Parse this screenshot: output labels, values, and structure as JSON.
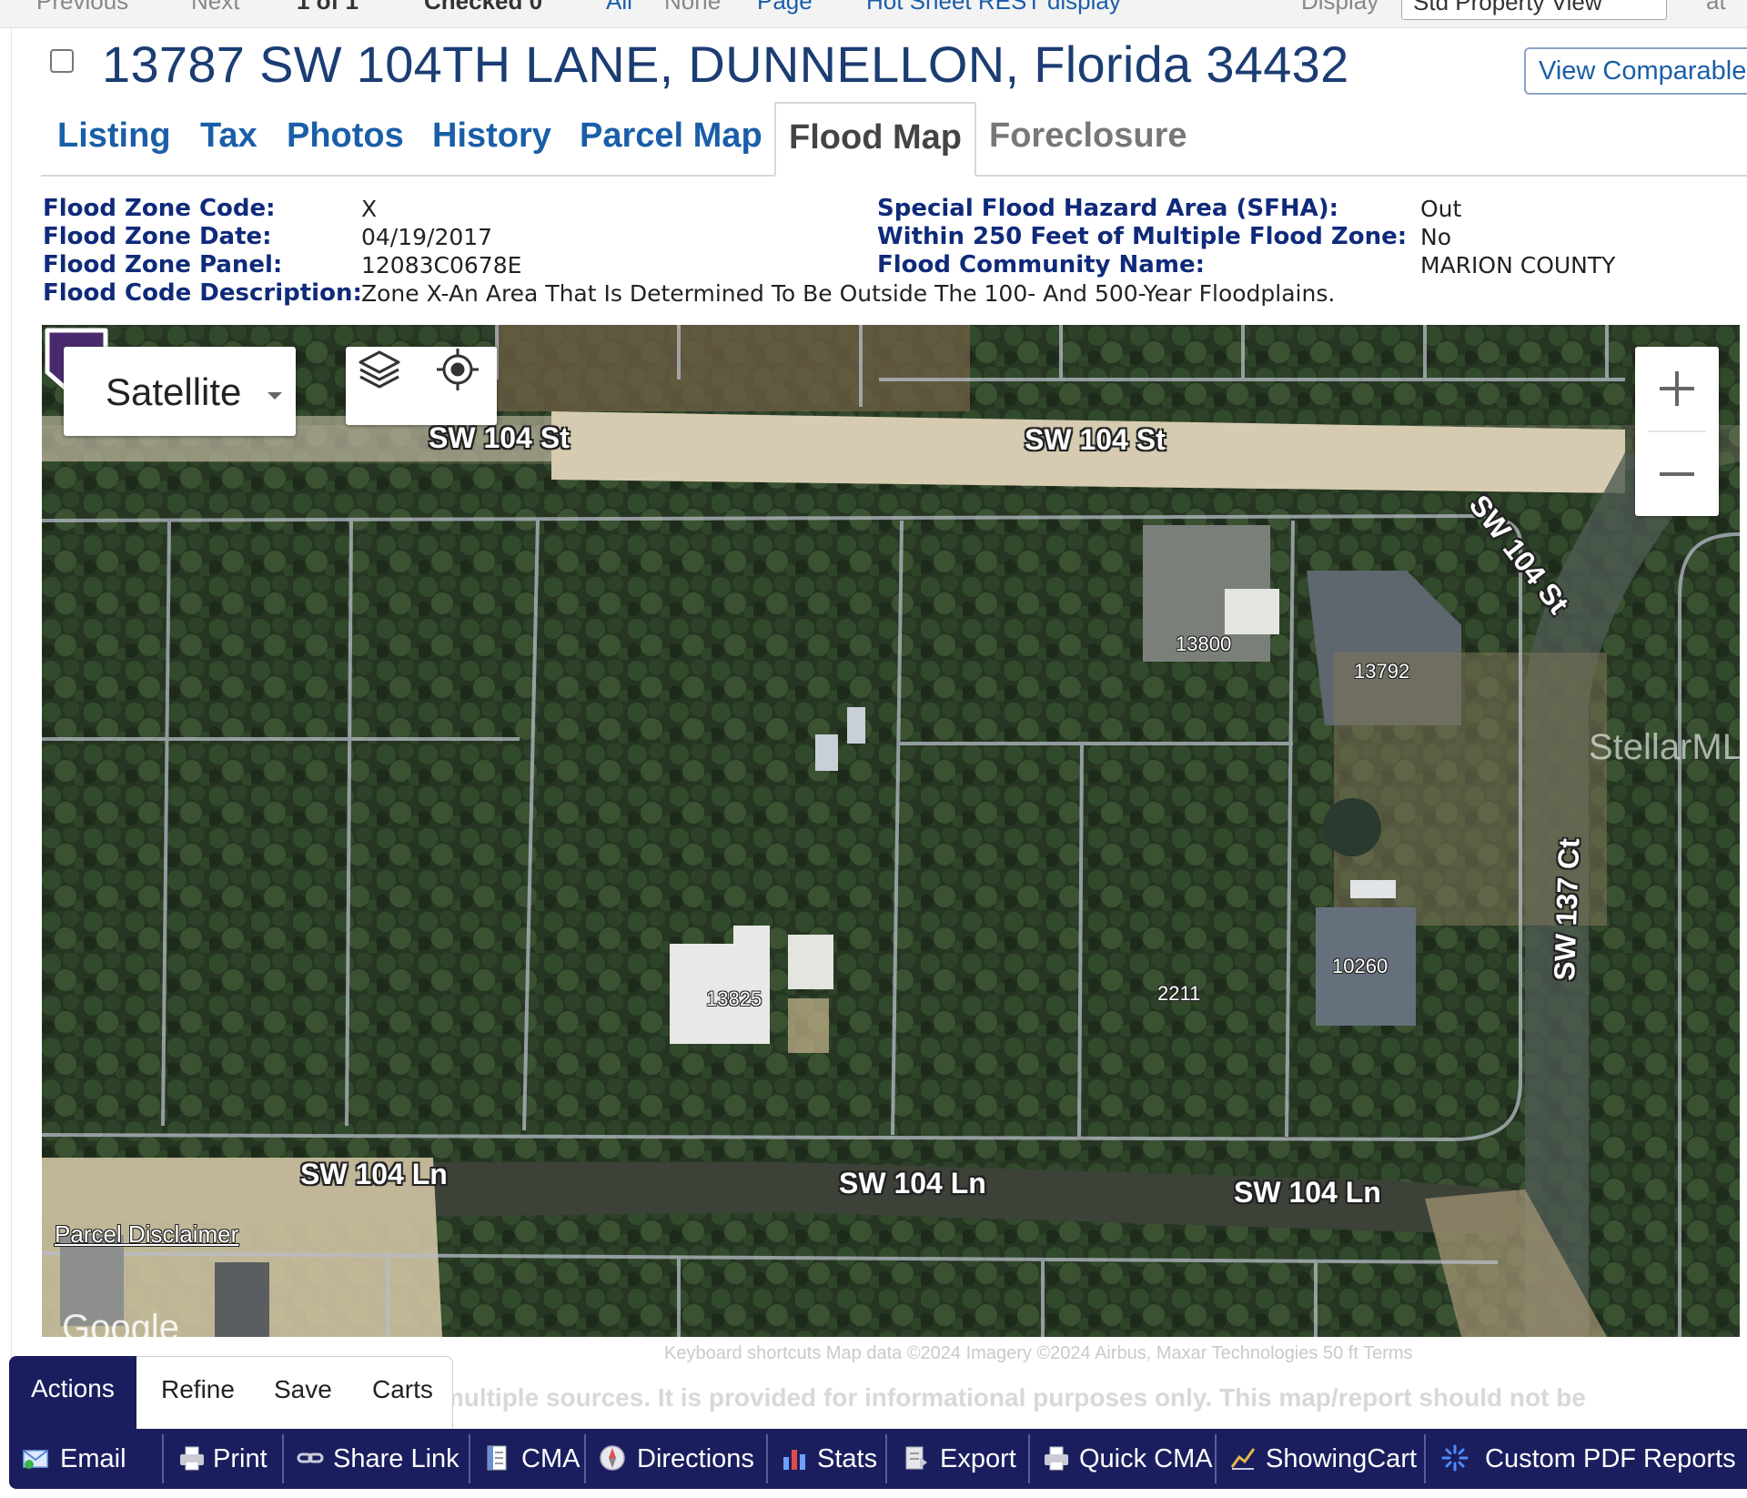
{
  "top_nav": {
    "previous": "Previous",
    "next": "Next",
    "count": "1 of 1",
    "checked": "Checked 0",
    "all": "All",
    "none": "None",
    "page": "Page",
    "hot_sheet": "Hot Sheet REST display",
    "display_label": "Display",
    "display_value": "Std Property View",
    "at": "at"
  },
  "listing": {
    "address": "13787 SW 104TH LANE, DUNNELLON, Florida 34432",
    "view_comparable": "View Comparable Properties"
  },
  "tabs": [
    {
      "label": "Listing"
    },
    {
      "label": "Tax"
    },
    {
      "label": "Photos"
    },
    {
      "label": "History"
    },
    {
      "label": "Parcel Map"
    },
    {
      "label": "Flood Map"
    },
    {
      "label": "Foreclosure"
    }
  ],
  "active_tab": "Flood Map",
  "flood": {
    "code_label": "Flood Zone Code:",
    "code": "X",
    "date_label": "Flood Zone Date:",
    "date": "04/19/2017",
    "panel_label": "Flood Zone Panel:",
    "panel": "12083C0678E",
    "desc_label": "Flood Code Description:",
    "desc": "Zone X-An Area That Is Determined To Be Outside The 100- And 500-Year Floodplains.",
    "sfha_label": "Special Flood Hazard Area (SFHA):",
    "sfha": "Out",
    "within_label": "Within 250 Feet of Multiple Flood Zone:",
    "within": "No",
    "community_label": "Flood Community Name:",
    "community": "MARION COUNTY"
  },
  "map": {
    "type_selector": "Satellite",
    "layers_icon": "layers-icon",
    "locate_icon": "crosshair-icon",
    "zoom_in": "+",
    "zoom_out": "−",
    "roads": {
      "north_a": "SW 104 St",
      "north_b": "SW 104 St",
      "northeast": "SW 104 St",
      "east": "SW 137 Ct",
      "south_a": "SW 104 Ln",
      "south_b": "SW 104 Ln",
      "south_c": "SW 104 Ln"
    },
    "house_numbers": {
      "h1": "13800",
      "h2": "13792",
      "h3": "13825",
      "h4": "10260"
    },
    "marker_label": "2211",
    "watermark": "StellarMLS",
    "parcel_disclaimer": "Parcel Disclaimer",
    "google": "Google",
    "attribution": "Keyboard shortcuts   Map data ©2024 Imagery ©2024 Airbus, Maxar Technologies   50 ft   Terms",
    "disclaimer_line1": "Map data compiled from multiple sources. It is provided for informational purposes only. This map/report should not be",
    "disclaimer_line2": ""
  },
  "action_tabs": [
    "Actions",
    "Refine",
    "Save",
    "Carts"
  ],
  "actions": [
    {
      "label": "Email",
      "icon": "email-icon"
    },
    {
      "label": "Print",
      "icon": "printer-icon"
    },
    {
      "label": "Share Link",
      "icon": "link-icon"
    },
    {
      "label": "CMA",
      "icon": "document-icon"
    },
    {
      "label": "Directions",
      "icon": "compass-icon"
    },
    {
      "label": "Stats",
      "icon": "bar-chart-icon"
    },
    {
      "label": "Export",
      "icon": "export-icon"
    },
    {
      "label": "Quick CMA",
      "icon": "printer-icon"
    },
    {
      "label": "ShowingCart",
      "icon": "chart-line-icon"
    },
    {
      "label": "Custom PDF Reports",
      "icon": "starburst-icon"
    }
  ],
  "colors": {
    "brand_navy": "#1b1e5e",
    "link_blue": "#1a5ea8",
    "label_navy": "#0f2a7a",
    "marker_purple": "#4a2a6e"
  }
}
